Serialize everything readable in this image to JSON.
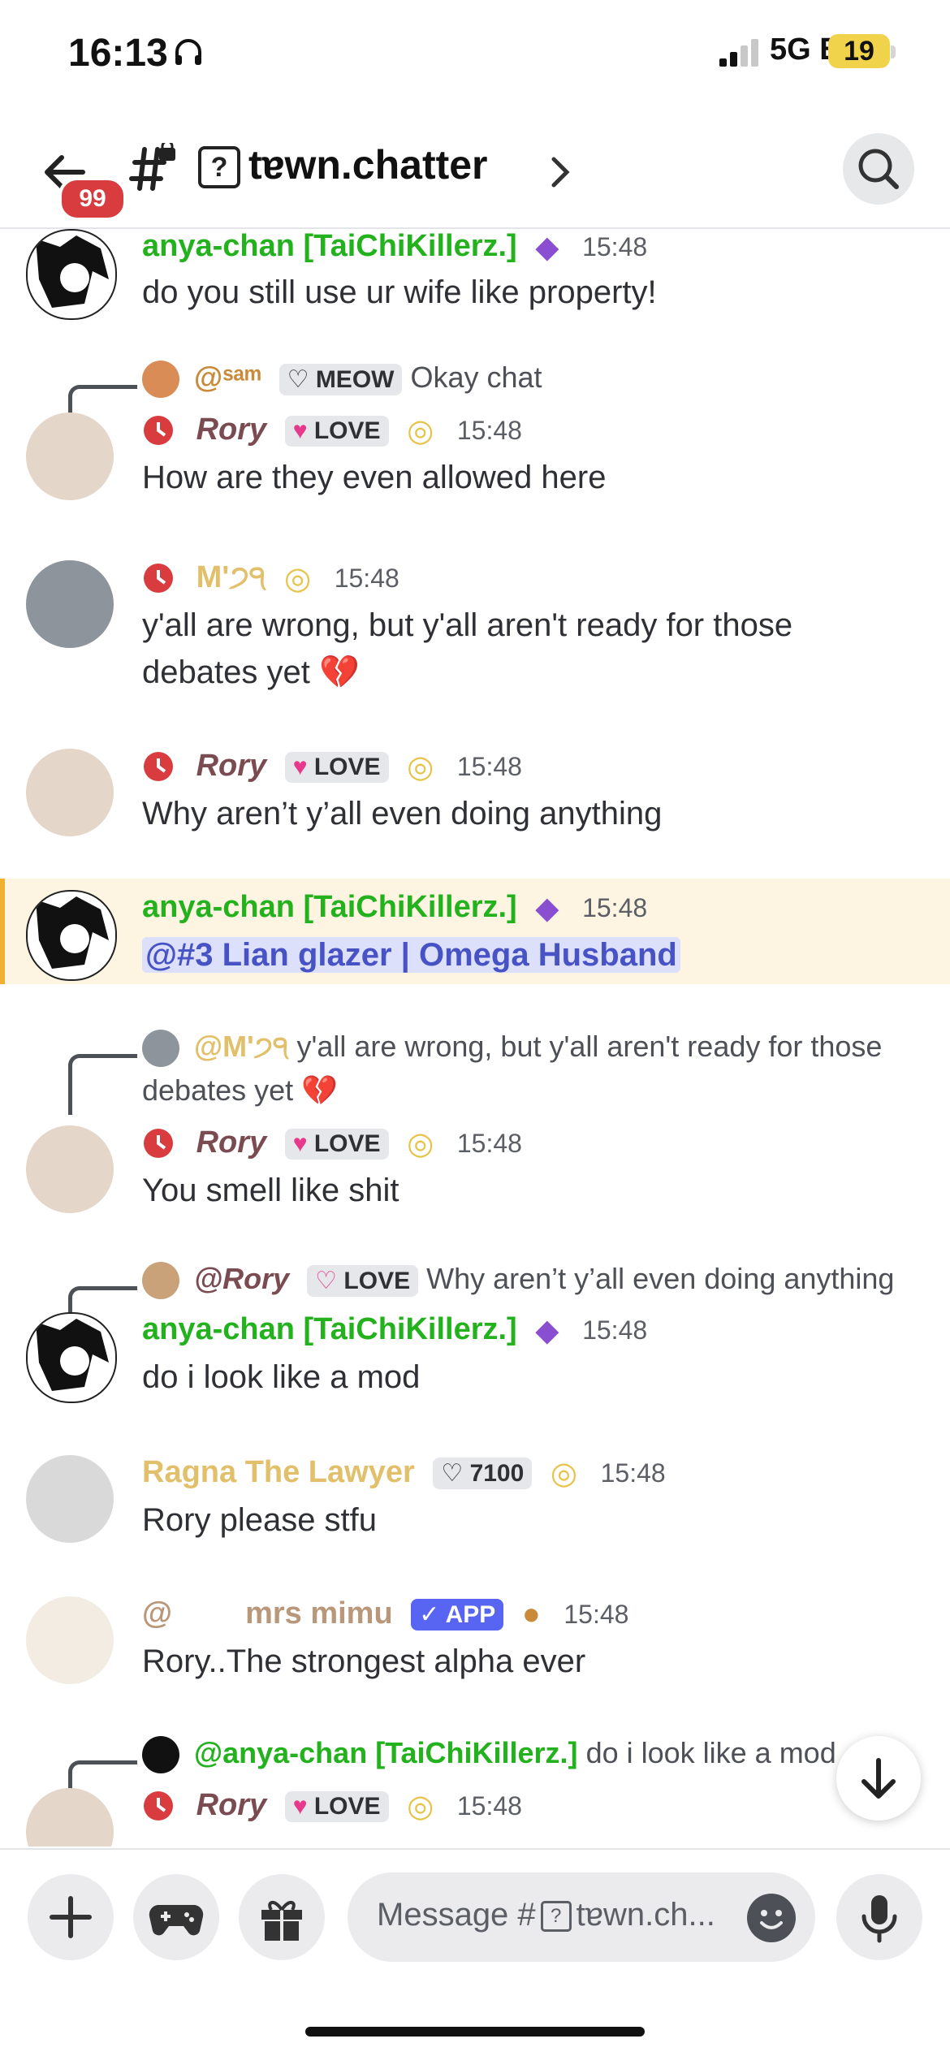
{
  "status_bar": {
    "time": "16:13",
    "network": "5G E",
    "battery": "19"
  },
  "header": {
    "unread_badge": "99",
    "channel_prefix": "?",
    "channel_name": "tɐwn.chatter"
  },
  "messages": [
    {
      "author": "anya-chan [TaiChiKillerz.]",
      "author_color": "#23b21e",
      "time": "15:48",
      "text": "do you still use ur wife like property!"
    },
    {
      "reply_author": "@ˢᵃᵐ",
      "reply_tag": "MEOW",
      "reply_text": "Okay chat",
      "author": "Rory",
      "tag": "LOVE",
      "time": "15:48",
      "text": "How are they even allowed here"
    },
    {
      "author": "M'੭੧",
      "time": "15:48",
      "text_line1": "y'all are wrong, but y'all aren't ready for those",
      "text_line2": "debates yet",
      "emoji": "💔"
    },
    {
      "author": "Rory",
      "tag": "LOVE",
      "time": "15:48",
      "text": "Why aren’t y’all even doing anything"
    },
    {
      "author": "anya-chan [TaiChiKillerz.]",
      "time": "15:48",
      "mention": "@#3 Lian glazer | Omega Husband"
    },
    {
      "reply_author": "@M'੭੧",
      "reply_text_line1": "y'all are wrong, but y'all aren't ready for those",
      "reply_text_line2": "debates yet",
      "author": "Rory",
      "tag": "LOVE",
      "time": "15:48",
      "text": "You smell like shit"
    },
    {
      "reply_author": "@Rory",
      "reply_tag": "LOVE",
      "reply_text": "Why aren’t y’all even doing anything",
      "author": "anya-chan [TaiChiKillerz.]",
      "time": "15:48",
      "text": "do i look like a mod"
    },
    {
      "author": "Ragna The Lawyer",
      "tag": "7100",
      "time": "15:48",
      "text": "Rory please stfu"
    },
    {
      "author_at": "@",
      "author": "mrs mimu",
      "tag": "✓ APP",
      "time": "15:48",
      "text": "Rory..The strongest alpha ever"
    },
    {
      "reply_author": "@anya-chan [TaiChiKillerz.]",
      "reply_text": "do i look like a mod",
      "author": "Rory",
      "tag": "LOVE",
      "time": "15:48"
    }
  ],
  "composer": {
    "placeholder": "Message #",
    "placeholder_channel": "tɐwn.ch..."
  },
  "icons": [
    "back-arrow-icon",
    "channel-hash-lock-icon",
    "search-icon",
    "plus-icon",
    "gamepad-icon",
    "gift-icon",
    "emoji-icon",
    "microphone-icon",
    "arrow-down-icon"
  ]
}
